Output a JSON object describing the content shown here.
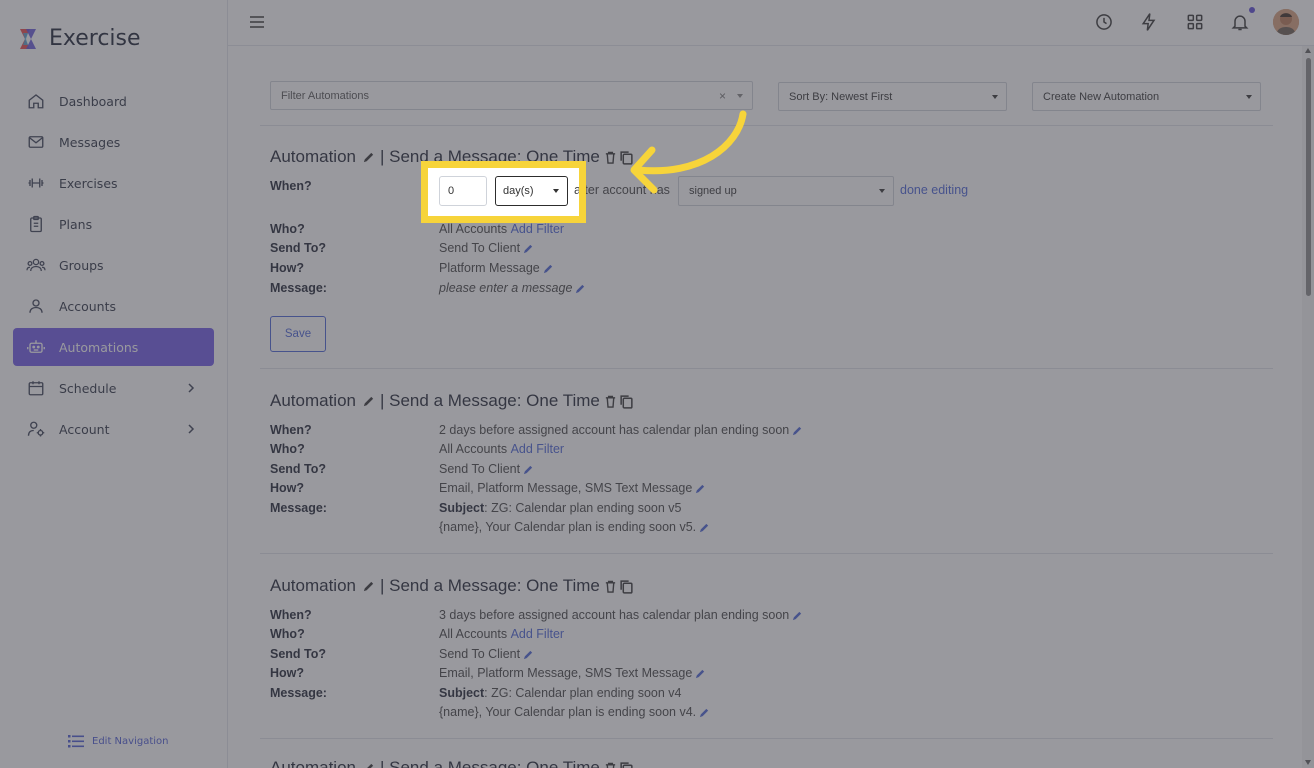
{
  "app": {
    "name": "Exercise"
  },
  "sidebar": {
    "items": [
      {
        "label": "Dashboard",
        "icon": "home-icon"
      },
      {
        "label": "Messages",
        "icon": "mail-icon"
      },
      {
        "label": "Exercises",
        "icon": "dumbbell-icon"
      },
      {
        "label": "Plans",
        "icon": "clipboard-icon"
      },
      {
        "label": "Groups",
        "icon": "users-icon"
      },
      {
        "label": "Accounts",
        "icon": "user-icon"
      },
      {
        "label": "Automations",
        "icon": "robot-icon",
        "active": true
      },
      {
        "label": "Schedule",
        "icon": "calendar-icon",
        "expandable": true
      },
      {
        "label": "Account",
        "icon": "user-gear-icon",
        "expandable": true
      }
    ],
    "edit_navigation": "Edit Navigation"
  },
  "topbar": {
    "icons": [
      "history-icon",
      "lightning-icon",
      "grid-icon",
      "bell-icon",
      "avatar"
    ],
    "accent": "#6f5ae6"
  },
  "filters": {
    "filter_placeholder": "Filter Automations",
    "sort_label": "Sort By: Newest First",
    "create_label": "Create New Automation"
  },
  "labels": {
    "when": "When?",
    "who": "Who?",
    "send_to": "Send To?",
    "how": "How?",
    "message": "Message:",
    "add_filter": "Add Filter",
    "subject": "Subject"
  },
  "automations": [
    {
      "title_prefix": "Automation",
      "title_suffix": "| Send a Message: One Time",
      "editing": {
        "number_value": "0",
        "unit_value": "day(s)",
        "after_text": "after account has",
        "event_value": "signed up",
        "done_label": "done editing"
      },
      "who": "All Accounts",
      "send_to": "Send To Client",
      "how": "Platform Message",
      "message": "please enter a message",
      "save_label": "Save"
    },
    {
      "title_prefix": "Automation",
      "title_suffix": "| Send a Message: One Time",
      "when": "2 days before assigned account has calendar plan ending soon",
      "who": "All Accounts",
      "send_to": "Send To Client",
      "how": "Email, Platform Message, SMS Text Message",
      "subject": ": ZG: Calendar plan ending soon v5",
      "body": "{name}, Your Calendar plan is ending soon v5."
    },
    {
      "title_prefix": "Automation",
      "title_suffix": "| Send a Message: One Time",
      "when": "3 days before assigned account has calendar plan ending soon",
      "who": "All Accounts",
      "send_to": "Send To Client",
      "how": "Email, Platform Message, SMS Text Message",
      "subject": ": ZG: Calendar plan ending soon v4",
      "body": "{name}, Your Calendar plan is ending soon v4."
    },
    {
      "title_prefix": "Automation",
      "title_suffix": "| Send a Message: One Time"
    }
  ],
  "highlight_color": "#f7d43a"
}
